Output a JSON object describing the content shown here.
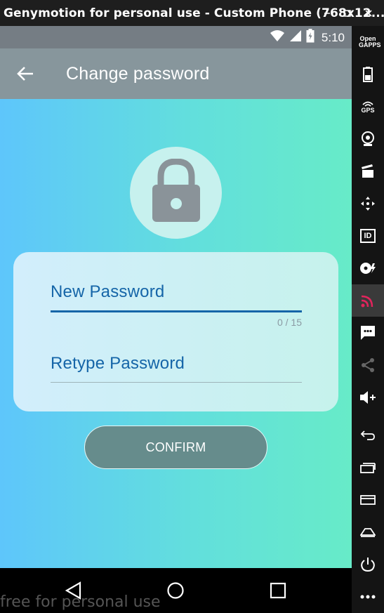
{
  "window": {
    "title": "Genymotion for personal use - Custom Phone (768x12...",
    "buttons": {
      "minimize_icon": "minimize-icon",
      "maximize_icon": "maximize-icon",
      "close_icon": "close-icon"
    }
  },
  "statusbar": {
    "time": "5:10",
    "icons": [
      "wifi-icon",
      "signal-icon",
      "battery-icon"
    ]
  },
  "appbar": {
    "title": "Change password",
    "back_icon": "arrow-back-icon"
  },
  "form": {
    "new_password": {
      "label": "New Password",
      "value": "",
      "counter": "0 / 15"
    },
    "retype_password": {
      "label": "Retype Password",
      "value": ""
    },
    "confirm_label": "CONFIRM"
  },
  "colors": {
    "primary": "#1565a8",
    "appbar": "#87969c",
    "button": "#668c8c",
    "accent_active": "#e2245c"
  },
  "navbar": {
    "buttons": [
      "nav-back-icon",
      "nav-home-icon",
      "nav-recents-icon"
    ]
  },
  "watermark": "free for personal use",
  "sidebar": {
    "opengapps_label": "Open GAPPS",
    "gps_label": "GPS",
    "id_label": "ID",
    "items": [
      "opengapps-icon",
      "battery-widget-icon",
      "gps-icon",
      "webcam-icon",
      "capture-icon",
      "move-icon",
      "device-id-icon",
      "disk-io-icon",
      "cast-icon",
      "sms-icon",
      "share-icon",
      "volume-up-icon",
      "back-icon",
      "recent-apps-icon",
      "menu-icon",
      "home-icon",
      "power-icon",
      "more-icon"
    ]
  }
}
